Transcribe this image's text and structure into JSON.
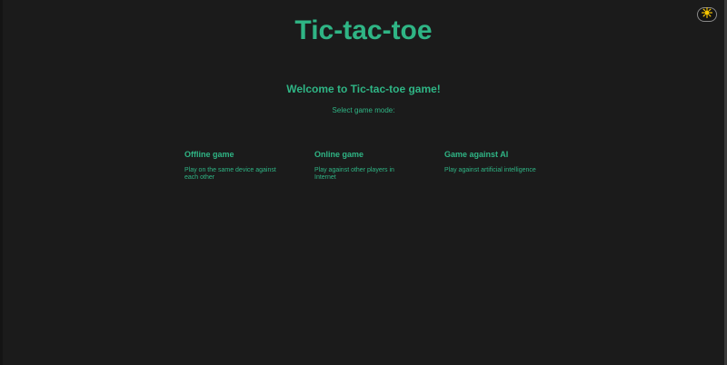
{
  "header": {
    "title": "Tic-tac-toe",
    "theme_toggle_icon": "sun-icon"
  },
  "main": {
    "welcome": "Welcome to Tic-tac-toe game!",
    "select_mode": "Select game mode:",
    "modes": [
      {
        "title": "Offline game",
        "description": "Play on the same device against each other"
      },
      {
        "title": "Online game",
        "description": "Play against other players in Internet"
      },
      {
        "title": "Game against AI",
        "description": "Play against artificial intelligence"
      }
    ]
  },
  "colors": {
    "accent": "#2fb585",
    "background": "#1b1b1b",
    "sun": "#f5c400"
  }
}
